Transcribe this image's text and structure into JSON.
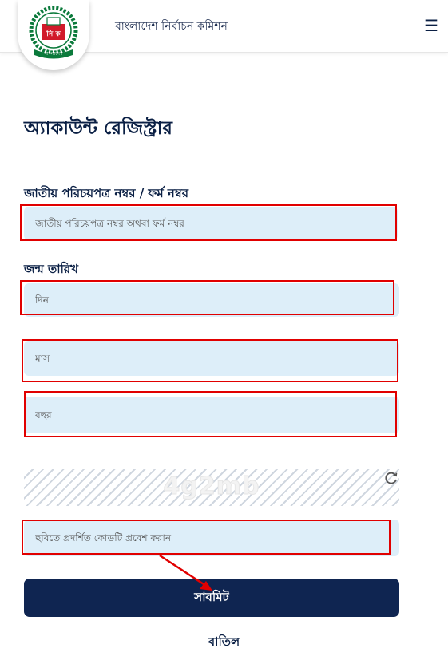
{
  "header": {
    "brand_name": "বাংলাদেশ নির্বাচন কমিশন",
    "logo_icon": "election-commission-seal-icon",
    "logo_text": "নি ক",
    "logo_ribbon_text": "বাংলাদেশ",
    "menu_icon": "hamburger-menu-icon",
    "menu_glyph": "☰"
  },
  "form": {
    "title": "অ্যাকাউন্ট রেজিস্ট্রার",
    "nid_label": "জাতীয় পরিচয়পত্র নম্বর / ফর্ম নম্বর",
    "nid_placeholder": "জাতীয় পরিচয়পত্র নম্বর অথবা ফর্ম নম্বর",
    "dob_label": "জন্ম তারিখ",
    "day_placeholder": "দিন",
    "month_placeholder": "মাস",
    "year_placeholder": "বছর",
    "captcha_text": "4g2mb",
    "refresh_icon": "refresh-icon",
    "captcha_placeholder": "ছবিতে প্রদর্শিত কোডটি প্রবেশ করান",
    "submit_label": "সাবমিট",
    "cancel_label": "বাতিল"
  },
  "colors": {
    "primary_navy": "#0f2551",
    "input_bg": "#ddeef9",
    "highlight_red": "#e10000",
    "logo_green": "#0b7a3b",
    "logo_red": "#d11a2a"
  }
}
